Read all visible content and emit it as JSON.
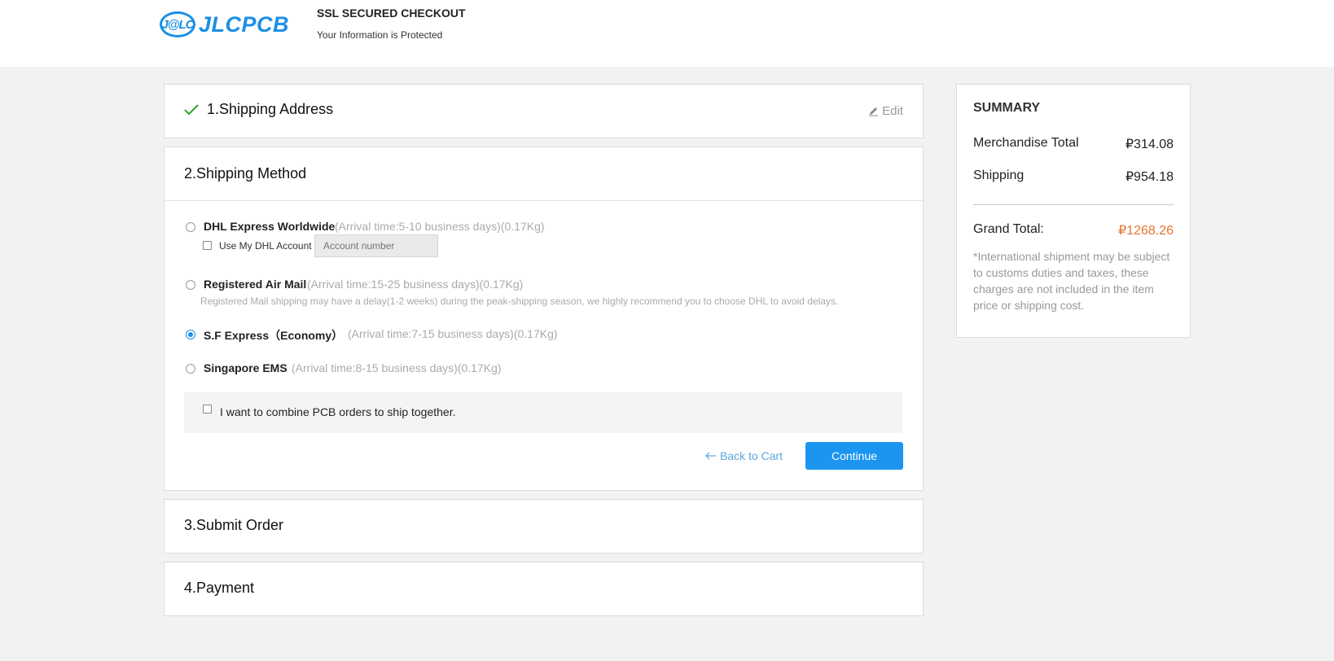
{
  "header": {
    "logo_mark": "J@LC",
    "logo_text": "JLCPCB",
    "ssl_title": "SSL SECURED CHECKOUT",
    "ssl_subtitle": "Your Information is Protected"
  },
  "steps": {
    "step1": {
      "title": "1.Shipping Address",
      "edit_label": "Edit",
      "completed": true
    },
    "step2": {
      "title": "2.Shipping Method"
    },
    "step3": {
      "title": "3.Submit Order"
    },
    "step4": {
      "title": "4.Payment"
    }
  },
  "shipping": {
    "selected": "S.F Express（Economy）",
    "options": [
      {
        "name": "DHL Express Worldwide",
        "arrival": "(Arrival time:5-10 business days)(0.17Kg)"
      },
      {
        "name": "Registered Air Mail",
        "arrival": "(Arrival time:15-25 business days)(0.17Kg)"
      },
      {
        "name": "S.F Express（Economy）",
        "arrival": "(Arrival time:7-15 business days)(0.17Kg)"
      },
      {
        "name": "Singapore EMS",
        "arrival": "(Arrival time:8-15 business days)(0.17Kg)"
      }
    ],
    "dhl_account_label": "Use My DHL Account",
    "account_placeholder": "Account number",
    "air_mail_note": "Registered Mail shipping may have a delay(1-2 weeks) during the peak-shipping season, we highly recommend you to choose DHL to avoid delays.",
    "combine_label": "I want to combine PCB orders to ship together.",
    "back_label": "Back to Cart",
    "continue_label": "Continue"
  },
  "summary": {
    "title": "SUMMARY",
    "merchandise_label": "Merchandise Total",
    "merchandise_value": "₽314.08",
    "shipping_label": "Shipping",
    "shipping_value": "₽954.18",
    "grand_label": "Grand Total:",
    "grand_value": "₽1268.26",
    "note": "*International shipment may be subject to customs duties and taxes, these charges are not included in the item price or shipping cost."
  },
  "colors": {
    "brand_blue": "#1b8fe6",
    "button_blue": "#1b95f0",
    "success_green": "#3aa635",
    "grand_total_orange": "#e8732c"
  }
}
